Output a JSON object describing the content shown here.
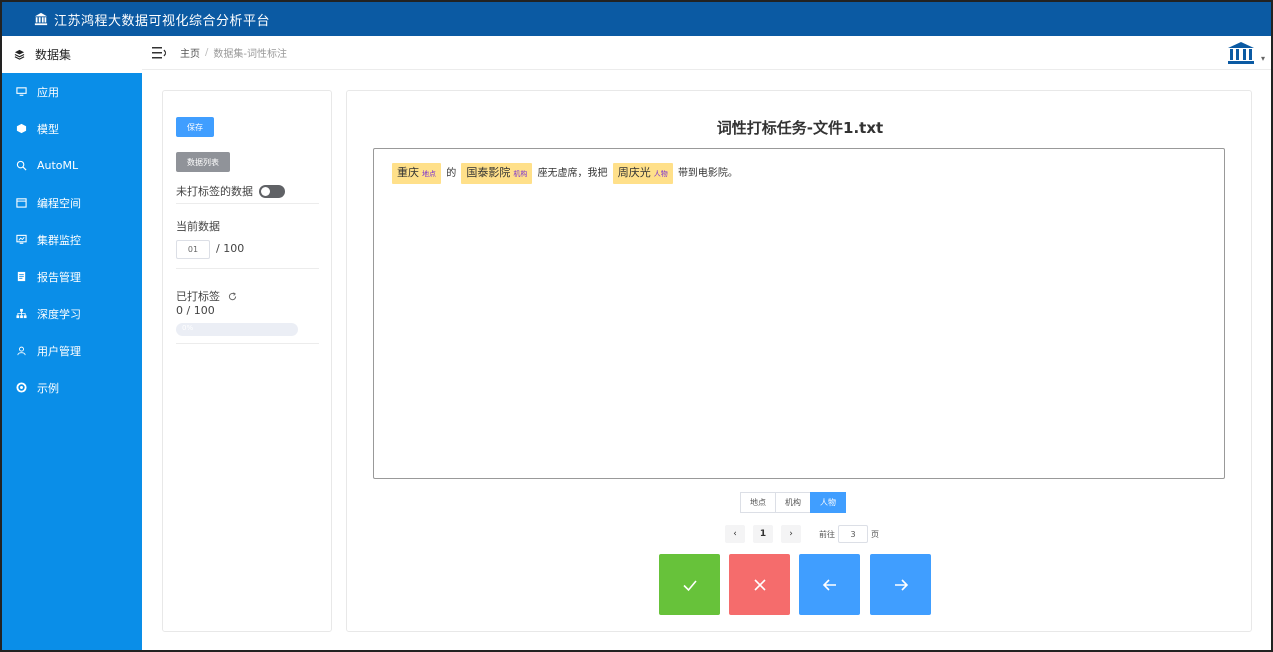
{
  "app": {
    "title": "江苏鸿程大数据可视化综合分析平台"
  },
  "sidebar": {
    "active": "数据集",
    "items": [
      {
        "label": "应用"
      },
      {
        "label": "模型"
      },
      {
        "label": "AutoML"
      },
      {
        "label": "编程空间"
      },
      {
        "label": "集群监控"
      },
      {
        "label": "报告管理"
      },
      {
        "label": "深度学习"
      },
      {
        "label": "用户管理"
      },
      {
        "label": "示例"
      }
    ]
  },
  "breadcrumb": {
    "home": "主页",
    "separator": "/",
    "current": "数据集-词性标注"
  },
  "left_panel": {
    "save_label": "保存",
    "list_label": "数据列表",
    "untagged_toggle_label": "未打标签的数据",
    "current_label": "当前数据",
    "current_value": "01",
    "current_total": "/ 100",
    "tagged_label": "已打标签",
    "tagged_count": "0 / 100",
    "progress_text": "0%",
    "progress_percent": 0
  },
  "main": {
    "title": "词性打标任务-文件1.txt",
    "text_segments": {
      "e1_word": "重庆",
      "e1_label": "地点",
      "t1": "的",
      "e2_word": "国泰影院",
      "e2_label": "机构",
      "t2": "座无虚席，我把",
      "e3_word": "周庆光",
      "e3_label": "人物",
      "t3": "带到电影院。"
    },
    "labels": [
      "地点",
      "机构",
      "人物"
    ],
    "active_label": "人物",
    "pager": {
      "prev": "‹",
      "page": "1",
      "next": "›",
      "goto_label": "前往",
      "goto_value": "3",
      "goto_suffix": "页"
    }
  },
  "colors": {
    "topbar": "#0b5aa3",
    "sidebar": "#0a8ee8",
    "primary": "#409eff",
    "success": "#67c23a",
    "danger": "#f56c6c",
    "highlight": "#ffe08a"
  }
}
